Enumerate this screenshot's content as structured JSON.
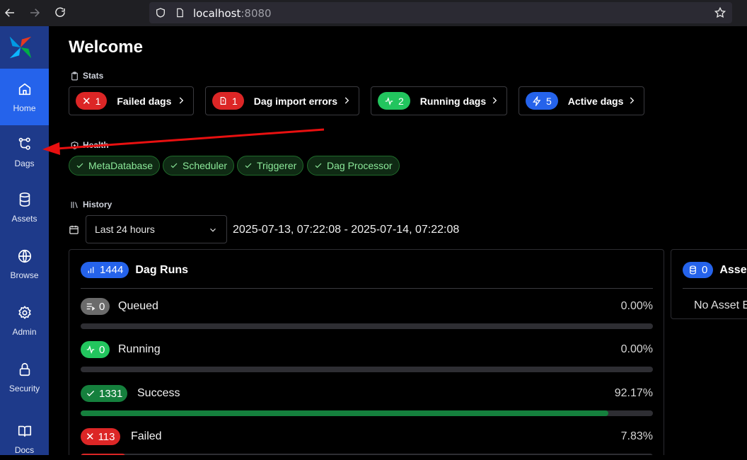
{
  "browser": {
    "url_host": "localhost",
    "url_port": ":8080"
  },
  "sidebar": {
    "items": [
      {
        "label": "Home",
        "icon": "home-icon",
        "active": true
      },
      {
        "label": "Dags",
        "icon": "dags-icon"
      },
      {
        "label": "Assets",
        "icon": "database-icon"
      },
      {
        "label": "Browse",
        "icon": "globe-icon"
      },
      {
        "label": "Admin",
        "icon": "gear-icon"
      },
      {
        "label": "Security",
        "icon": "lock-icon"
      },
      {
        "label": "Docs",
        "icon": "book-icon"
      }
    ]
  },
  "main": {
    "title": "Welcome",
    "stats": {
      "label": "Stats",
      "cards": [
        {
          "count": "1",
          "label": "Failed dags",
          "color": "#dc2626"
        },
        {
          "count": "1",
          "label": "Dag import errors",
          "color": "#dc2626"
        },
        {
          "count": "2",
          "label": "Running dags",
          "color": "#22c55e"
        },
        {
          "count": "5",
          "label": "Active dags",
          "color": "#2563eb"
        }
      ]
    },
    "health": {
      "label": "Health",
      "items": [
        "MetaDatabase",
        "Scheduler",
        "Triggerer",
        "Dag Processor"
      ]
    },
    "history": {
      "label": "History",
      "range_select": "Last 24 hours",
      "range_text": "2025-07-13, 07:22:08 - 2025-07-14, 07:22:08"
    },
    "dag_runs": {
      "count": "1444",
      "title": "Dag Runs",
      "rows": [
        {
          "count": "0",
          "label": "Queued",
          "pct": "0.00%",
          "fraction": 0,
          "color": "#6b6b6b"
        },
        {
          "count": "0",
          "label": "Running",
          "pct": "0.00%",
          "fraction": 0,
          "color": "#22c55e"
        },
        {
          "count": "1331",
          "label": "Success",
          "pct": "92.17%",
          "fraction": 0.9217,
          "color": "#15803d"
        },
        {
          "count": "113",
          "label": "Failed",
          "pct": "7.83%",
          "fraction": 0.0783,
          "color": "#dc2626"
        }
      ]
    },
    "assets": {
      "count": "0",
      "title": "Asse",
      "empty": "No Asset E"
    }
  }
}
